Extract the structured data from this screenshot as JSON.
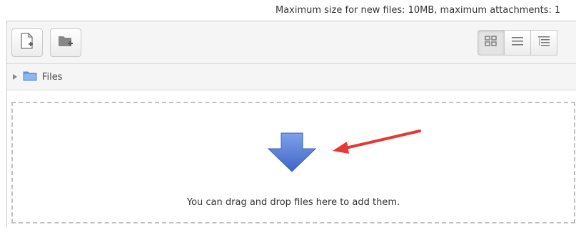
{
  "header": {
    "max_size_text": "Maximum size for new files: 10MB, maximum attachments: 1"
  },
  "toolbar": {
    "add_icon": "add-file-icon",
    "create_folder_icon": "create-folder-icon",
    "views": [
      {
        "icon": "icon-view-icon",
        "active": true
      },
      {
        "icon": "list-view-icon",
        "active": false
      },
      {
        "icon": "tree-view-icon",
        "active": false
      }
    ]
  },
  "path": {
    "label": "Files"
  },
  "dropzone": {
    "message": "You can drag and drop files here to add them."
  },
  "colors": {
    "arrow_blue": "#5b7fd6",
    "annotation_red": "#e53935"
  }
}
